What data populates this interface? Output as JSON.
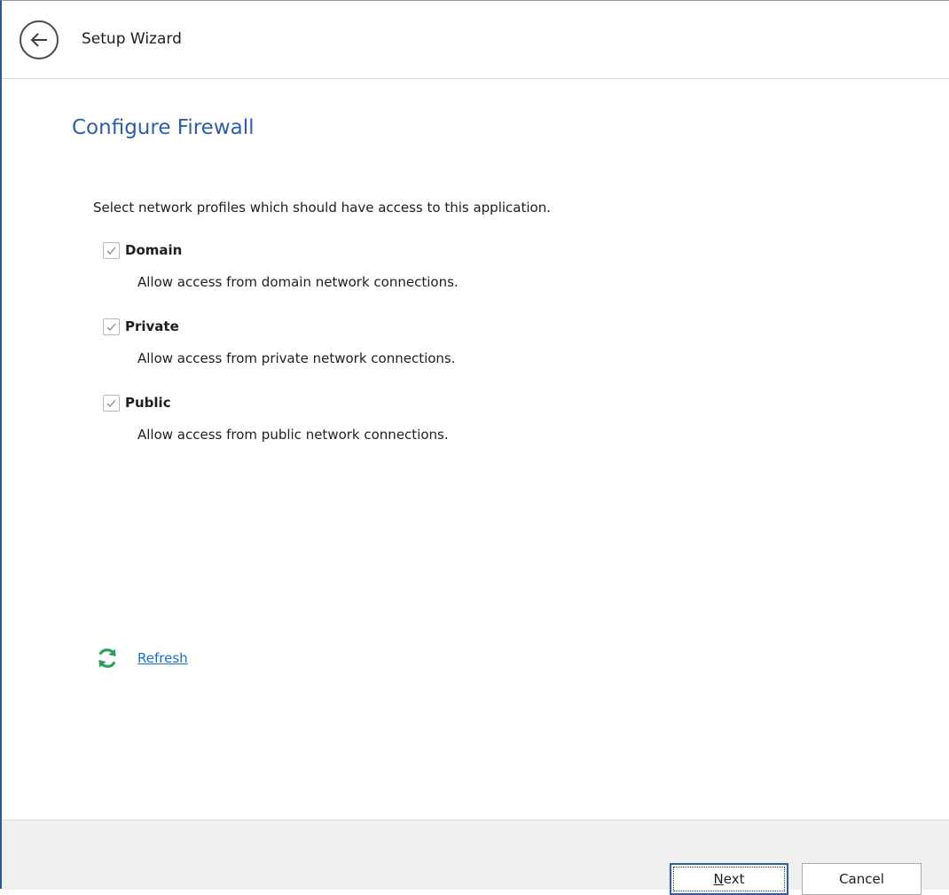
{
  "header": {
    "title": "Setup Wizard",
    "back_icon": "arrow-left-icon"
  },
  "page": {
    "title": "Configure Firewall",
    "instructions": "Select network profiles which should have access to this application."
  },
  "profiles": [
    {
      "label": "Domain",
      "description": "Allow access from domain network connections.",
      "checked": true
    },
    {
      "label": "Private",
      "description": "Allow access from private network connections.",
      "checked": true
    },
    {
      "label": "Public",
      "description": "Allow access from public network connections.",
      "checked": true
    }
  ],
  "refresh": {
    "label": "Refresh",
    "icon": "refresh-icon",
    "icon_color": "#2e9e5b"
  },
  "footer": {
    "next_mnemonic": "N",
    "next_rest": "ext",
    "cancel_label": "Cancel"
  },
  "colors": {
    "accent": "#2f5ea8",
    "link": "#1a6fc9"
  }
}
